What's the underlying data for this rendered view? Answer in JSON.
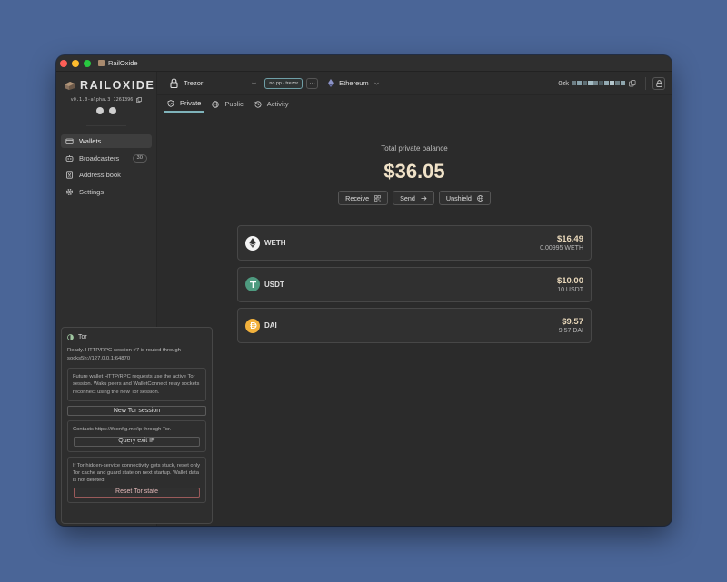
{
  "window": {
    "title": "RailOxide"
  },
  "sidebar": {
    "brand": "RAILOXIDE",
    "version": "v0.1.0-alpha.3 1261396",
    "items": [
      {
        "label": "Wallets",
        "icon": "wallet-icon",
        "active": true
      },
      {
        "label": "Broadcasters",
        "icon": "broadcaster-icon",
        "badge": "30"
      },
      {
        "label": "Address book",
        "icon": "address-book-icon"
      },
      {
        "label": "Settings",
        "icon": "gear-icon"
      }
    ]
  },
  "tor": {
    "title": "Tor",
    "status": "Ready. HTTP/RPC session #7 is routed through socks5h://127.0.0.1:64870",
    "info": "Future wallet HTTP/RPC requests use the active Tor session. Waku peers and WalletConnect relay sockets reconnect using the new Tor session.",
    "new_session_label": "New Tor session",
    "exit_info": "Contacts https://ifconfig.me/ip through Tor.",
    "query_exit_label": "Query exit IP",
    "reset_info": "If Tor hidden-service connectivity gets stuck, reset only Tor cache and guard state on next startup. Wallet data is not deleted.",
    "reset_label": "Reset Tor state"
  },
  "topbar": {
    "wallet_name": "Trezor",
    "wallet_tag": "no pp / trezor",
    "more_label": "···",
    "network": "Ethereum",
    "address_prefix": "0zk"
  },
  "tabs": [
    {
      "label": "Private",
      "icon": "shield-icon",
      "active": true
    },
    {
      "label": "Public",
      "icon": "globe-icon"
    },
    {
      "label": "Activity",
      "icon": "history-icon"
    }
  ],
  "balance": {
    "label": "Total private balance",
    "value": "$36.05"
  },
  "actions": {
    "receive": "Receive",
    "send": "Send",
    "unshield": "Unshield"
  },
  "assets": [
    {
      "symbol": "WETH",
      "usd": "$16.49",
      "amount": "0.00995 WETH",
      "color": "#f4f4f4"
    },
    {
      "symbol": "USDT",
      "usd": "$10.00",
      "amount": "10 USDT",
      "color": "#4e9a7f"
    },
    {
      "symbol": "DAI",
      "usd": "$9.57",
      "amount": "9.57 DAI",
      "color": "#f2b13c"
    }
  ],
  "colors": {
    "accent": "#7fb3ba",
    "balance": "#f0e2c8",
    "desktop": "#4a6597"
  }
}
